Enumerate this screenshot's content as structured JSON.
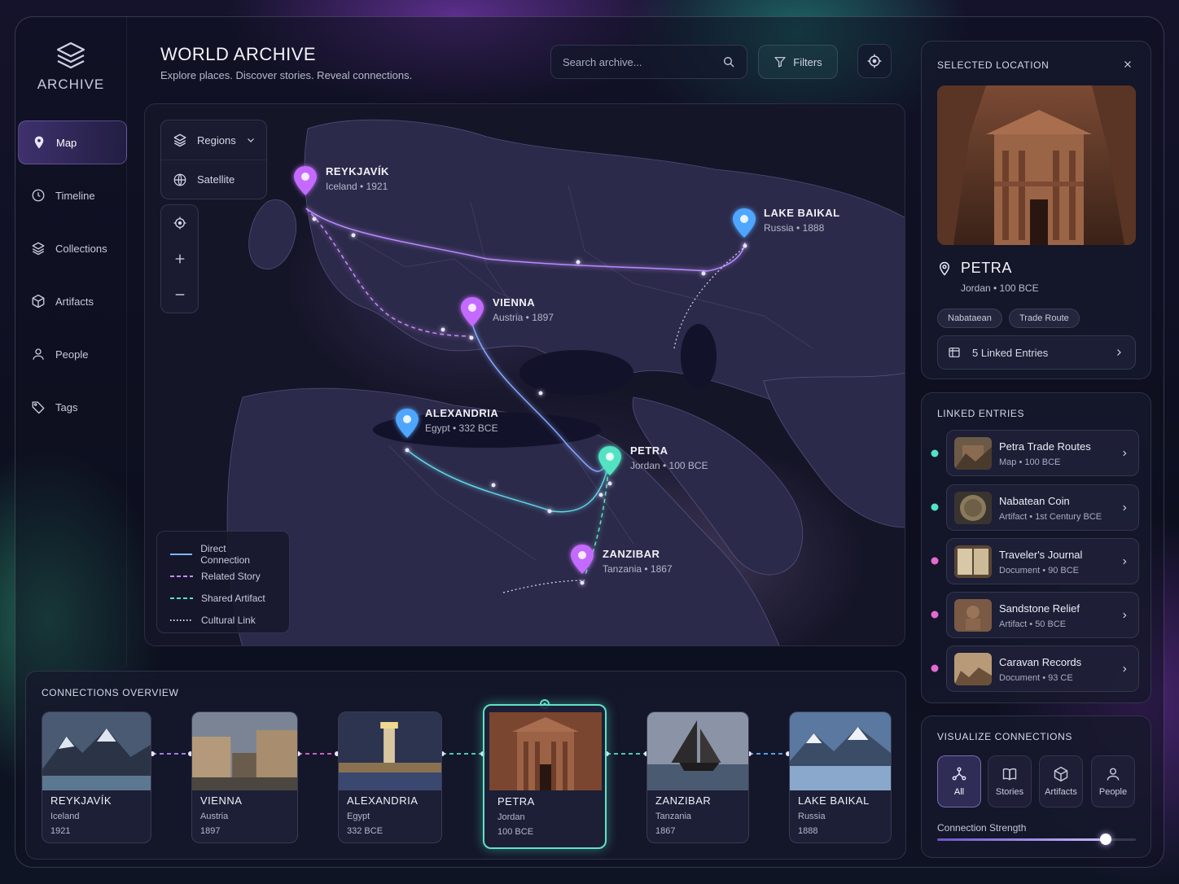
{
  "app": {
    "logo_text": "ARCHIVE"
  },
  "header": {
    "title": "WORLD ARCHIVE",
    "subtitle": "Explore places. Discover stories. Reveal connections.",
    "search_placeholder": "Search archive...",
    "filters_label": "Filters"
  },
  "sidebar": {
    "items": [
      {
        "label": "Map",
        "icon": "map-pin-icon",
        "active": true
      },
      {
        "label": "Timeline",
        "icon": "clock-icon"
      },
      {
        "label": "Collections",
        "icon": "layers-icon"
      },
      {
        "label": "Artifacts",
        "icon": "cube-icon"
      },
      {
        "label": "People",
        "icon": "person-icon"
      },
      {
        "label": "Tags",
        "icon": "tag-icon"
      }
    ]
  },
  "map": {
    "layers": [
      {
        "label": "Regions",
        "icon": "layers-icon"
      },
      {
        "label": "Satellite",
        "icon": "globe-icon"
      }
    ],
    "pins": [
      {
        "name": "REYKJAVÍK",
        "sub": "Iceland • 1921",
        "color": "#c46bff"
      },
      {
        "name": "LAKE BAIKAL",
        "sub": "Russia • 1888",
        "color": "#4fa6ff"
      },
      {
        "name": "VIENNA",
        "sub": "Austria • 1897",
        "color": "#c46bff"
      },
      {
        "name": "ALEXANDRIA",
        "sub": "Egypt • 332 BCE",
        "color": "#4fa6ff"
      },
      {
        "name": "PETRA",
        "sub": "Jordan • 100 BCE",
        "color": "#52e3c2"
      },
      {
        "name": "ZANZIBAR",
        "sub": "Tanzania • 1867",
        "color": "#c46bff"
      }
    ],
    "legend": [
      {
        "label": "Direct Connection",
        "color": "#7fb6ff",
        "style": "solid"
      },
      {
        "label": "Related Story",
        "color": "#c98bff",
        "style": "dashed"
      },
      {
        "label": "Shared Artifact",
        "color": "#52e3c2",
        "style": "dashed"
      },
      {
        "label": "Cultural Link",
        "color": "#d8d8ee",
        "style": "dotted"
      }
    ]
  },
  "selected": {
    "panel_title": "SELECTED LOCATION",
    "name": "PETRA",
    "sub": "Jordan • 100 BCE",
    "tags": [
      "Nabataean",
      "Trade Route"
    ],
    "linked_button": "5 Linked Entries"
  },
  "linked_entries": {
    "panel_title": "LINKED ENTRIES",
    "items": [
      {
        "title": "Petra Trade Routes",
        "sub": "Map  •  100 BCE",
        "dot": "#52e3c2"
      },
      {
        "title": "Nabatean Coin",
        "sub": "Artifact  •  1st Century BCE",
        "dot": "#52e3c2"
      },
      {
        "title": "Traveler's Journal",
        "sub": "Document  •  90 BCE",
        "dot": "#e36bd0"
      },
      {
        "title": "Sandstone Relief",
        "sub": "Artifact  •  50 BCE",
        "dot": "#e36bd0"
      },
      {
        "title": "Caravan Records",
        "sub": "Document  •  93 CE",
        "dot": "#e36bd0"
      }
    ]
  },
  "visualize": {
    "panel_title": "VISUALIZE CONNECTIONS",
    "options": [
      {
        "label": "All",
        "icon": "network-icon",
        "active": true
      },
      {
        "label": "Stories",
        "icon": "book-icon"
      },
      {
        "label": "Artifacts",
        "icon": "cube-icon"
      },
      {
        "label": "People",
        "icon": "person-icon"
      }
    ],
    "strength_label": "Connection Strength",
    "strength_value": 0.85
  },
  "overview": {
    "panel_title": "CONNECTIONS OVERVIEW",
    "cards": [
      {
        "name": "REYKJAVÍK",
        "country": "Iceland",
        "year": "1921"
      },
      {
        "name": "VIENNA",
        "country": "Austria",
        "year": "1897"
      },
      {
        "name": "ALEXANDRIA",
        "country": "Egypt",
        "year": "332 BCE"
      },
      {
        "name": "PETRA",
        "country": "Jordan",
        "year": "100 BCE",
        "active": true
      },
      {
        "name": "ZANZIBAR",
        "country": "Tanzania",
        "year": "1867"
      },
      {
        "name": "LAKE BAIKAL",
        "country": "Russia",
        "year": "1888"
      }
    ]
  }
}
